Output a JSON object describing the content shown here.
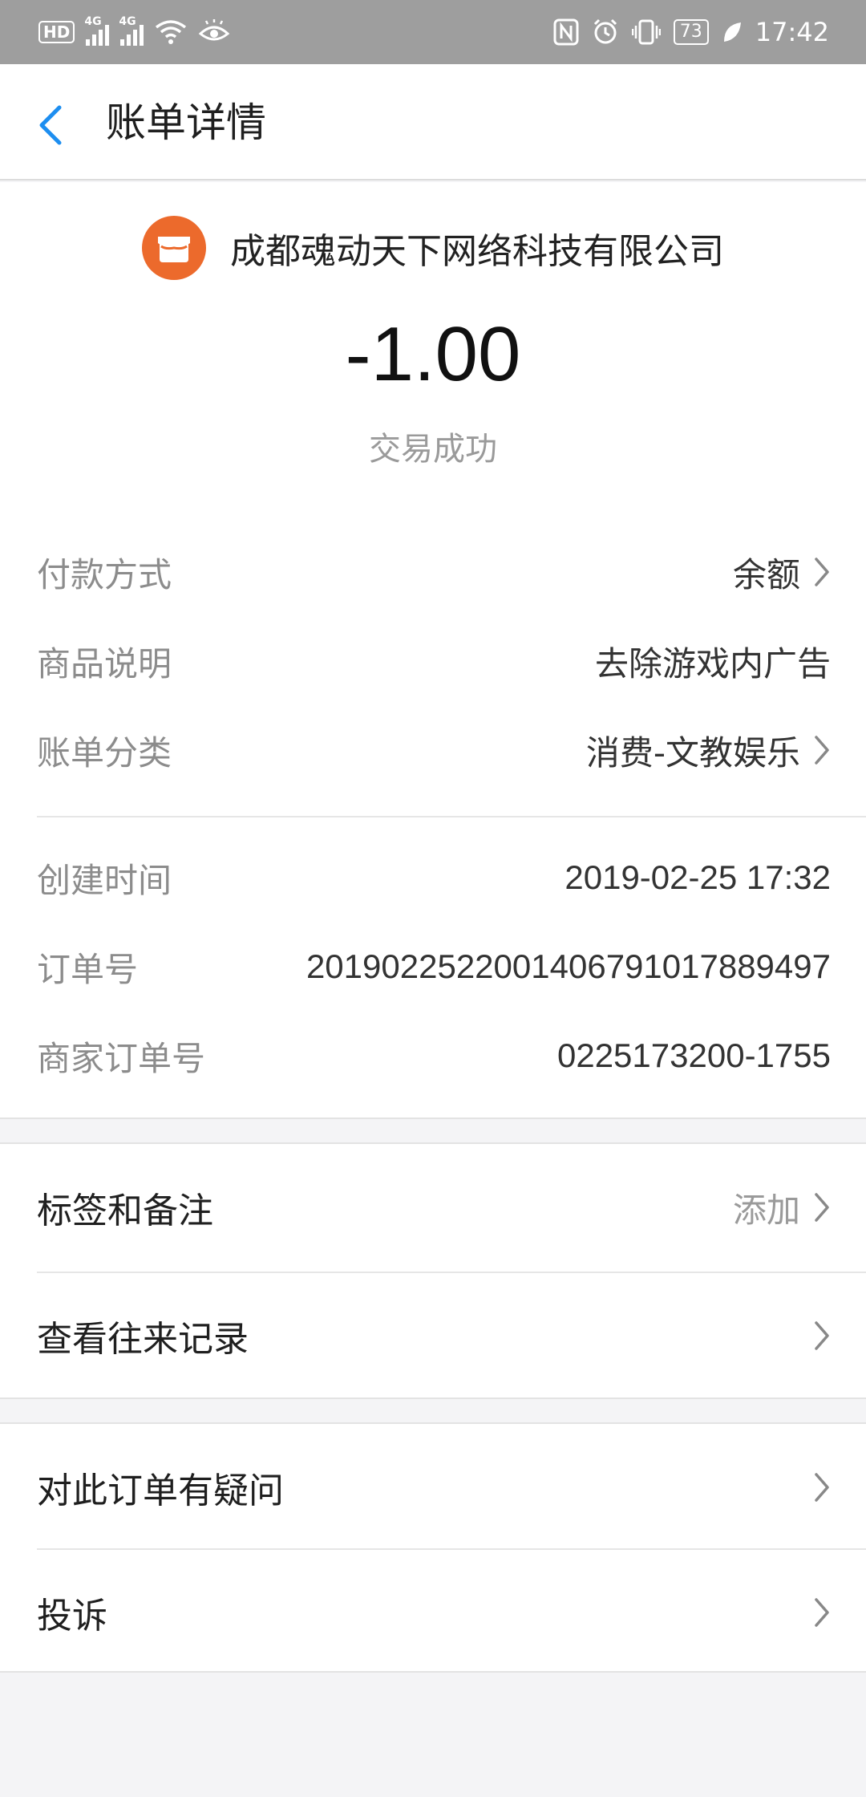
{
  "status_bar": {
    "hd": "HD",
    "signal1": "4G",
    "signal2": "4G",
    "battery": "73",
    "time": "17:42"
  },
  "header": {
    "back_icon": "chevron-left-icon",
    "title": "账单详情"
  },
  "summary": {
    "merchant_icon": "storefront-icon",
    "merchant": "成都魂动天下网络科技有限公司",
    "amount": "-1.00",
    "status": "交易成功"
  },
  "details": [
    {
      "label": "付款方式",
      "value": "余额"
    },
    {
      "label": "商品说明",
      "value": "去除游戏内广告"
    },
    {
      "label": "账单分类",
      "value": "消费-文教娱乐"
    }
  ],
  "order_info": [
    {
      "label": "创建时间",
      "value": "2019-02-25 17:32"
    },
    {
      "label": "订单号",
      "value": "2019022522001406791017889497"
    },
    {
      "label": "商家订单号",
      "value": "0225173200-1755"
    }
  ],
  "actions": {
    "tags": {
      "label": "标签和备注",
      "value": "添加"
    },
    "history": {
      "label": "查看往来记录"
    },
    "question": {
      "label": "对此订单有疑问"
    },
    "complaint": {
      "label": "投诉"
    }
  },
  "colors": {
    "status_bar": "#9e9e9e",
    "accent_blue": "#1d8ef0",
    "merchant_orange": "#ec6a2c",
    "background": "#f4f4f6"
  }
}
